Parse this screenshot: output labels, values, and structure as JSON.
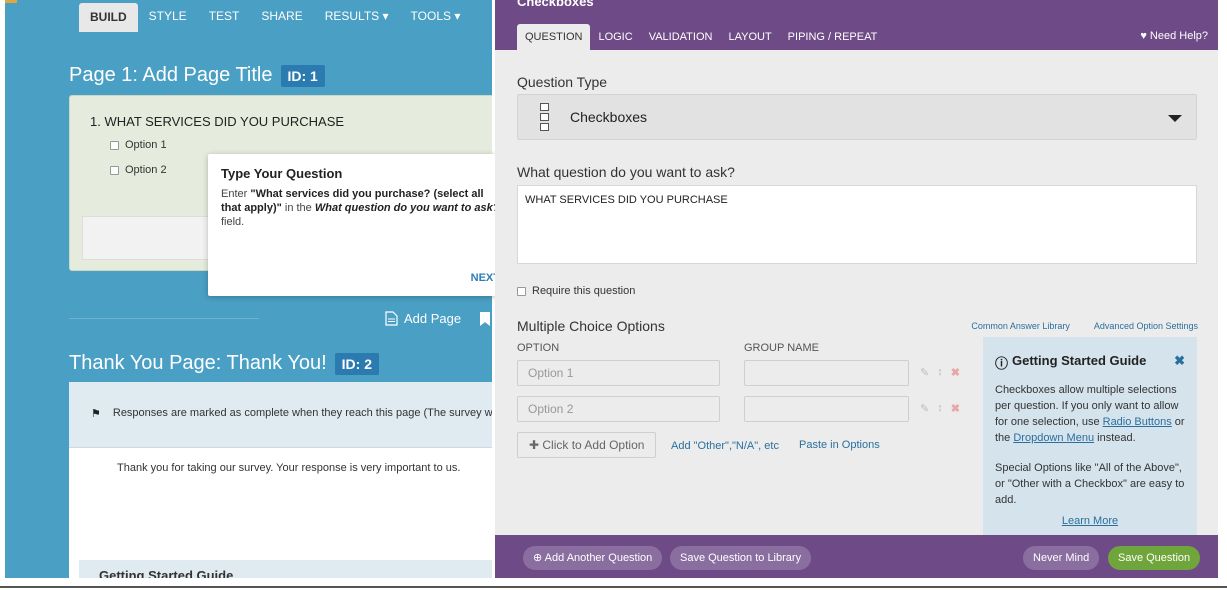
{
  "left": {
    "tabs": [
      {
        "label": "BUILD",
        "active": true
      },
      {
        "label": "STYLE",
        "active": false
      },
      {
        "label": "TEST",
        "active": false
      },
      {
        "label": "SHARE",
        "active": false
      },
      {
        "label": "RESULTS ▾",
        "active": false
      },
      {
        "label": "TOOLS ▾",
        "active": false
      }
    ],
    "page1": {
      "title": "Page 1: Add Page Title",
      "id": "ID: 1"
    },
    "question": {
      "title": "1. WHAT SERVICES DID YOU PURCHASE",
      "options": [
        "Option 1",
        "Option 2"
      ]
    },
    "add_page_label": "Add Page",
    "thankyou": {
      "title": "Thank You Page: Thank You!",
      "id": "ID: 2",
      "notice": "Responses are marked as complete when they reach this page (The survey wil",
      "body": "Thank you for taking our survey. Your response is very important to us.",
      "guide_strip": "Getting Started Guide"
    }
  },
  "popover": {
    "close": "×",
    "title": "Type Your Question",
    "body_prefix": "Enter ",
    "body_bold": "\"What services did you purchase? (select all that apply)\"",
    "body_mid": " in the ",
    "body_italic": "What question do you want to ask?",
    "body_suffix": " field.",
    "next": "NEXT"
  },
  "editor": {
    "title": "Checkboxes",
    "tabs": [
      {
        "label": "QUESTION",
        "active": true
      },
      {
        "label": "LOGIC",
        "active": false
      },
      {
        "label": "VALIDATION",
        "active": false
      },
      {
        "label": "LAYOUT",
        "active": false
      },
      {
        "label": "PIPING / REPEAT",
        "active": false
      }
    ],
    "need_help": "♥ Need Help?",
    "question_type_label": "Question Type",
    "question_type_value": "Checkboxes",
    "question_text_label": "What question do you want to ask?",
    "question_text_value": "WHAT SERVICES DID YOU PURCHASE",
    "require_label": "Require this question",
    "mc_label": "Multiple Choice Options",
    "common_answer_library": "Common Answer Library",
    "advanced_option_settings": "Advanced Option Settings",
    "col_option": "OPTION",
    "col_group": "GROUP NAME",
    "option_rows": [
      {
        "placeholder": "Option 1"
      },
      {
        "placeholder": "Option 2"
      }
    ],
    "add_option": "✚ Click to Add Option",
    "add_other": "Add \"Other\",\"N/A\", etc",
    "paste_options": "Paste in Options",
    "guide": {
      "title": "Getting Started Guide",
      "info_icon": "ⓘ",
      "close": "✖",
      "text_a": "Checkboxes allow multiple selections per question. If you only want to allow for one selection, use ",
      "link_radio": "Radio Buttons",
      "text_b": " or the ",
      "link_dropdown": "Dropdown Menu",
      "text_c": " instead.",
      "link_special": "Special Options",
      "text_d": " like \"All of the Above\", or \"Other with a Checkbox\" are easy to add.",
      "learn_more": "Learn More"
    },
    "footer": {
      "add_another": "⊕ Add Another Question",
      "save_library": "Save Question to Library",
      "never_mind": "Never Mind",
      "save_question": "Save Question"
    }
  },
  "colors": {
    "left_bg": "#4a9fc4",
    "purple": "#6e4a86",
    "save_green": "#6fa53a",
    "link_blue": "#2a6f9e"
  }
}
